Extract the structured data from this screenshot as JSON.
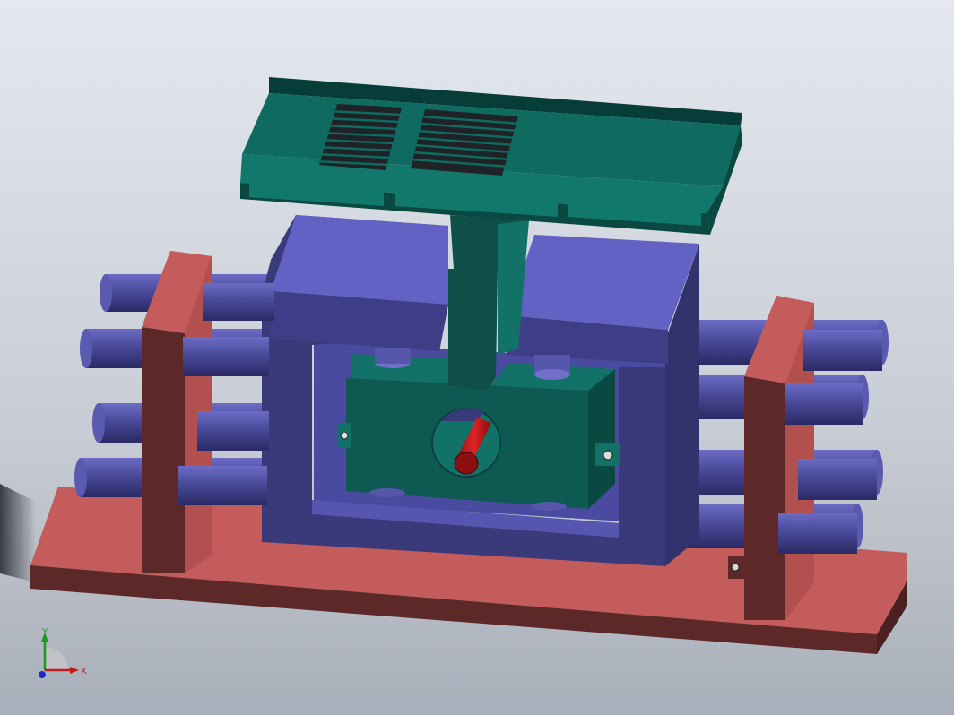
{
  "triad": {
    "x_label": "X",
    "y_label": "Y",
    "z_label": ""
  },
  "colors": {
    "background_top": "#dde2ea",
    "background_bottom": "#aeb4bf",
    "base_top": "#c45c5c",
    "base_side": "#5e2a2a",
    "frame_front": "#3a3a7a",
    "frame_top": "#6060c0",
    "frame_inner": "#5050aa",
    "cylinder": "#4a4a96",
    "cylinder_highlight": "#7070c8",
    "core_front": "#0e5a52",
    "core_top": "#137268",
    "rod": "#cc1a1a",
    "tray": "#0f6a60",
    "tray_dark": "#073d38"
  }
}
